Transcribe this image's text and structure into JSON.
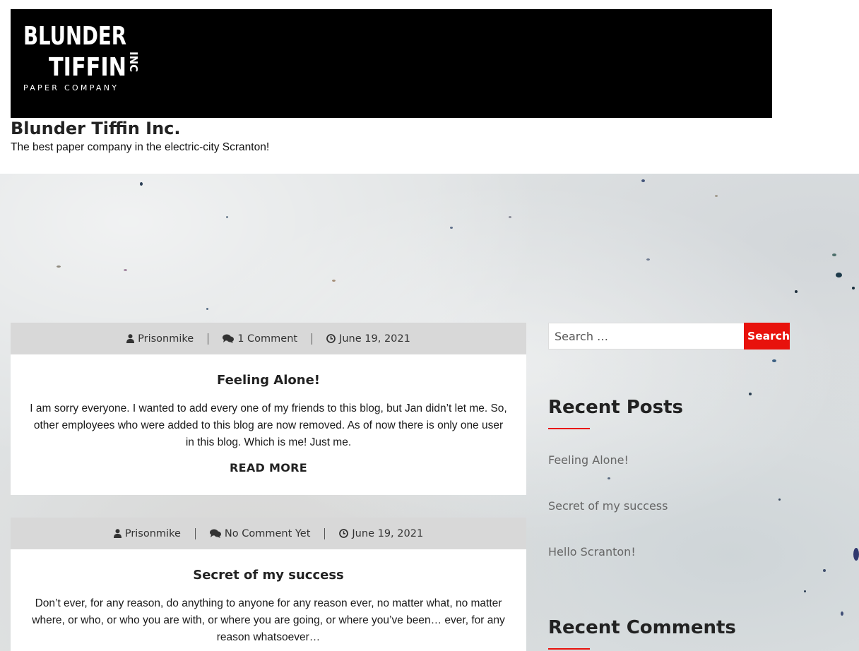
{
  "site": {
    "logo": {
      "line1": "BLUNDER",
      "line2": "TIFFIN",
      "inc": "INC",
      "subtitle": "PAPER COMPANY"
    },
    "title": "Blunder Tiffin Inc.",
    "tagline": "The best paper company in the electric-city Scranton!"
  },
  "posts": [
    {
      "author": "Prisonmike",
      "comments": "1 Comment",
      "date": "June 19, 2021",
      "title": "Feeling Alone!",
      "excerpt": "I am sorry everyone. I wanted to add every one of my friends to this blog, but Jan didn’t let me. So, other employees who were added to this blog are now removed. As of now there is only one user in this blog. Which is me! Just me.",
      "read_more": "READ MORE"
    },
    {
      "author": "Prisonmike",
      "comments": "No Comment Yet",
      "date": "June 19, 2021",
      "title": "Secret of my success",
      "excerpt": "Don’t ever, for any reason, do anything to anyone for any reason ever, no matter what, no matter where, or who, or who you are with, or where you are going, or where you’ve been… ever, for any reason whatsoever…"
    }
  ],
  "sidebar": {
    "search": {
      "placeholder": "Search …",
      "button": "Search"
    },
    "recent_posts": {
      "title": "Recent Posts",
      "items": [
        "Feeling Alone!",
        "Secret of my success",
        "Hello Scranton!"
      ]
    },
    "recent_comments": {
      "title": "Recent Comments"
    }
  },
  "colors": {
    "accent": "#e8120c",
    "meta_bar": "#d8d8d8",
    "banner": "#000000"
  },
  "icons": {
    "author": "user-icon",
    "comments": "comments-icon",
    "date": "clock-icon"
  }
}
